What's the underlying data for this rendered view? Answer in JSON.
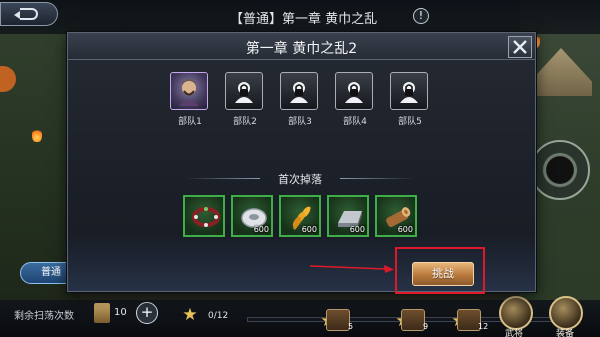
{
  "topbar": {
    "title": "【普通】第一章 黄巾之乱",
    "back_icon": "back-arrow-icon",
    "info_icon": "!"
  },
  "left": {
    "mode_button": "普通"
  },
  "dialog": {
    "title": "第一章 黄巾之乱2",
    "close_icon": "close-icon",
    "troops": [
      {
        "label": "部队1",
        "state": "unlocked"
      },
      {
        "label": "部队2",
        "state": "locked"
      },
      {
        "label": "部队3",
        "state": "locked"
      },
      {
        "label": "部队4",
        "state": "locked"
      },
      {
        "label": "部队5",
        "state": "locked"
      }
    ],
    "drops_title": "首次掉落",
    "drops": [
      {
        "item": "bracelet",
        "qty": ""
      },
      {
        "item": "silver-coin",
        "qty": "600"
      },
      {
        "item": "wheat",
        "qty": "600"
      },
      {
        "item": "iron-ingot",
        "qty": "600"
      },
      {
        "item": "wood-log",
        "qty": "600"
      }
    ],
    "challenge_button": "挑战",
    "highlight_color": "#e0192a"
  },
  "bottombar": {
    "sweep_label": "剩余扫荡次数",
    "sweep_count": "10",
    "stars": "0/12",
    "chests": [
      "5",
      "9",
      "12"
    ],
    "buttons": [
      {
        "label": "武将"
      },
      {
        "label": "装备"
      }
    ]
  }
}
